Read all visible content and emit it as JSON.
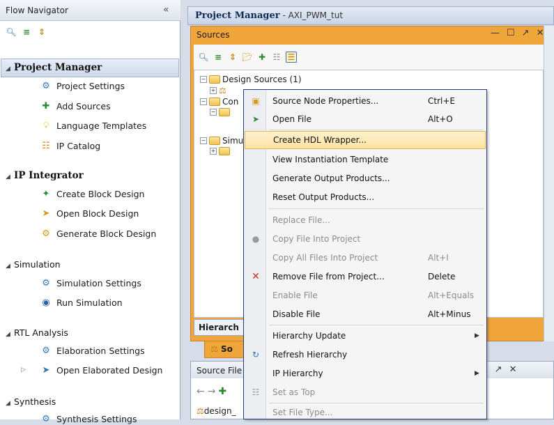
{
  "flow_navigator": {
    "title": "Flow Navigator",
    "collapse_label": "«",
    "sections": {
      "project_manager": {
        "label": "Project Manager",
        "items": [
          "Project Settings",
          "Add Sources",
          "Language Templates",
          "IP Catalog"
        ]
      },
      "ip_integrator": {
        "label": "IP Integrator",
        "items": [
          "Create Block Design",
          "Open Block Design",
          "Generate Block Design"
        ]
      },
      "simulation": {
        "label": "Simulation",
        "items": [
          "Simulation Settings",
          "Run Simulation"
        ]
      },
      "rtl_analysis": {
        "label": "RTL Analysis",
        "items": [
          "Elaboration Settings",
          "Open Elaborated Design"
        ]
      },
      "synthesis": {
        "label": "Synthesis",
        "items": [
          "Synthesis Settings"
        ]
      }
    }
  },
  "project_manager_bar": {
    "title": "Project Manager",
    "subtitle": " - AXI_PWM_tut"
  },
  "sources_panel": {
    "title": "Sources",
    "tree": {
      "design_sources": "Design Sources (1)",
      "constraints": "Con",
      "simulation_sources": "Simu"
    },
    "bottom_tab": "Hierarch",
    "tab_label": "So"
  },
  "source_file_panel": {
    "title": "Source File",
    "file": "design_"
  },
  "context_menu": {
    "items": [
      {
        "label": "Source Node Properties...",
        "shortcut": "Ctrl+E"
      },
      {
        "label": "Open File",
        "shortcut": "Alt+O"
      },
      {
        "label": "Create HDL Wrapper..."
      },
      {
        "label": "View Instantiation Template"
      },
      {
        "label": "Generate Output Products..."
      },
      {
        "label": "Reset Output Products..."
      },
      {
        "label": "Replace File..."
      },
      {
        "label": "Copy File Into Project"
      },
      {
        "label": "Copy All Files Into Project",
        "shortcut": "Alt+I"
      },
      {
        "label": "Remove File from Project...",
        "shortcut": "Delete"
      },
      {
        "label": "Enable File",
        "shortcut": "Alt+Equals"
      },
      {
        "label": "Disable File",
        "shortcut": "Alt+Minus"
      },
      {
        "label": "Hierarchy Update"
      },
      {
        "label": "Refresh Hierarchy"
      },
      {
        "label": "IP Hierarchy"
      },
      {
        "label": "Set as Top"
      },
      {
        "label": "Set File Type..."
      }
    ]
  },
  "colors": {
    "accent_orange": "#f0a53a",
    "highlight": "#fde3a3",
    "menu_border": "#223c7a"
  }
}
